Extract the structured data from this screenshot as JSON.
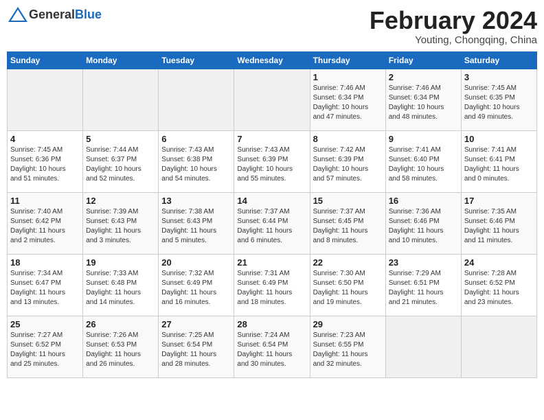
{
  "header": {
    "logo_general": "General",
    "logo_blue": "Blue",
    "title": "February 2024",
    "subtitle": "Youting, Chongqing, China"
  },
  "weekdays": [
    "Sunday",
    "Monday",
    "Tuesday",
    "Wednesday",
    "Thursday",
    "Friday",
    "Saturday"
  ],
  "weeks": [
    [
      {
        "day": "",
        "info": ""
      },
      {
        "day": "",
        "info": ""
      },
      {
        "day": "",
        "info": ""
      },
      {
        "day": "",
        "info": ""
      },
      {
        "day": "1",
        "info": "Sunrise: 7:46 AM\nSunset: 6:34 PM\nDaylight: 10 hours\nand 47 minutes."
      },
      {
        "day": "2",
        "info": "Sunrise: 7:46 AM\nSunset: 6:34 PM\nDaylight: 10 hours\nand 48 minutes."
      },
      {
        "day": "3",
        "info": "Sunrise: 7:45 AM\nSunset: 6:35 PM\nDaylight: 10 hours\nand 49 minutes."
      }
    ],
    [
      {
        "day": "4",
        "info": "Sunrise: 7:45 AM\nSunset: 6:36 PM\nDaylight: 10 hours\nand 51 minutes."
      },
      {
        "day": "5",
        "info": "Sunrise: 7:44 AM\nSunset: 6:37 PM\nDaylight: 10 hours\nand 52 minutes."
      },
      {
        "day": "6",
        "info": "Sunrise: 7:43 AM\nSunset: 6:38 PM\nDaylight: 10 hours\nand 54 minutes."
      },
      {
        "day": "7",
        "info": "Sunrise: 7:43 AM\nSunset: 6:39 PM\nDaylight: 10 hours\nand 55 minutes."
      },
      {
        "day": "8",
        "info": "Sunrise: 7:42 AM\nSunset: 6:39 PM\nDaylight: 10 hours\nand 57 minutes."
      },
      {
        "day": "9",
        "info": "Sunrise: 7:41 AM\nSunset: 6:40 PM\nDaylight: 10 hours\nand 58 minutes."
      },
      {
        "day": "10",
        "info": "Sunrise: 7:41 AM\nSunset: 6:41 PM\nDaylight: 11 hours\nand 0 minutes."
      }
    ],
    [
      {
        "day": "11",
        "info": "Sunrise: 7:40 AM\nSunset: 6:42 PM\nDaylight: 11 hours\nand 2 minutes."
      },
      {
        "day": "12",
        "info": "Sunrise: 7:39 AM\nSunset: 6:43 PM\nDaylight: 11 hours\nand 3 minutes."
      },
      {
        "day": "13",
        "info": "Sunrise: 7:38 AM\nSunset: 6:43 PM\nDaylight: 11 hours\nand 5 minutes."
      },
      {
        "day": "14",
        "info": "Sunrise: 7:37 AM\nSunset: 6:44 PM\nDaylight: 11 hours\nand 6 minutes."
      },
      {
        "day": "15",
        "info": "Sunrise: 7:37 AM\nSunset: 6:45 PM\nDaylight: 11 hours\nand 8 minutes."
      },
      {
        "day": "16",
        "info": "Sunrise: 7:36 AM\nSunset: 6:46 PM\nDaylight: 11 hours\nand 10 minutes."
      },
      {
        "day": "17",
        "info": "Sunrise: 7:35 AM\nSunset: 6:46 PM\nDaylight: 11 hours\nand 11 minutes."
      }
    ],
    [
      {
        "day": "18",
        "info": "Sunrise: 7:34 AM\nSunset: 6:47 PM\nDaylight: 11 hours\nand 13 minutes."
      },
      {
        "day": "19",
        "info": "Sunrise: 7:33 AM\nSunset: 6:48 PM\nDaylight: 11 hours\nand 14 minutes."
      },
      {
        "day": "20",
        "info": "Sunrise: 7:32 AM\nSunset: 6:49 PM\nDaylight: 11 hours\nand 16 minutes."
      },
      {
        "day": "21",
        "info": "Sunrise: 7:31 AM\nSunset: 6:49 PM\nDaylight: 11 hours\nand 18 minutes."
      },
      {
        "day": "22",
        "info": "Sunrise: 7:30 AM\nSunset: 6:50 PM\nDaylight: 11 hours\nand 19 minutes."
      },
      {
        "day": "23",
        "info": "Sunrise: 7:29 AM\nSunset: 6:51 PM\nDaylight: 11 hours\nand 21 minutes."
      },
      {
        "day": "24",
        "info": "Sunrise: 7:28 AM\nSunset: 6:52 PM\nDaylight: 11 hours\nand 23 minutes."
      }
    ],
    [
      {
        "day": "25",
        "info": "Sunrise: 7:27 AM\nSunset: 6:52 PM\nDaylight: 11 hours\nand 25 minutes."
      },
      {
        "day": "26",
        "info": "Sunrise: 7:26 AM\nSunset: 6:53 PM\nDaylight: 11 hours\nand 26 minutes."
      },
      {
        "day": "27",
        "info": "Sunrise: 7:25 AM\nSunset: 6:54 PM\nDaylight: 11 hours\nand 28 minutes."
      },
      {
        "day": "28",
        "info": "Sunrise: 7:24 AM\nSunset: 6:54 PM\nDaylight: 11 hours\nand 30 minutes."
      },
      {
        "day": "29",
        "info": "Sunrise: 7:23 AM\nSunset: 6:55 PM\nDaylight: 11 hours\nand 32 minutes."
      },
      {
        "day": "",
        "info": ""
      },
      {
        "day": "",
        "info": ""
      }
    ]
  ]
}
